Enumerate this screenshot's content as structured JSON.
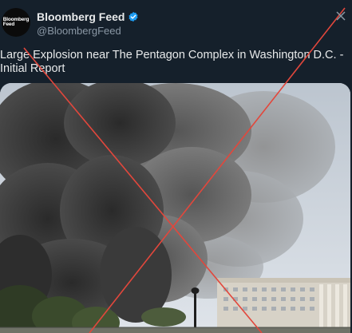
{
  "account": {
    "avatar_text": "Bloomberg\nFeed",
    "display_name": "Bloomberg Feed",
    "handle": "@BloombergFeed",
    "verified": true
  },
  "tweet": {
    "text": "Large Explosion near The Pentagon Complex in Washington D.C. - Initial Report"
  },
  "media": {
    "description_icon": "photo-icon"
  },
  "overlay": {
    "cross_color": "#e2473c"
  },
  "colors": {
    "background": "#15202b",
    "verified_badge": "#1d9bf0",
    "text": "#e7e9ea",
    "secondary_text": "#8b98a5"
  }
}
